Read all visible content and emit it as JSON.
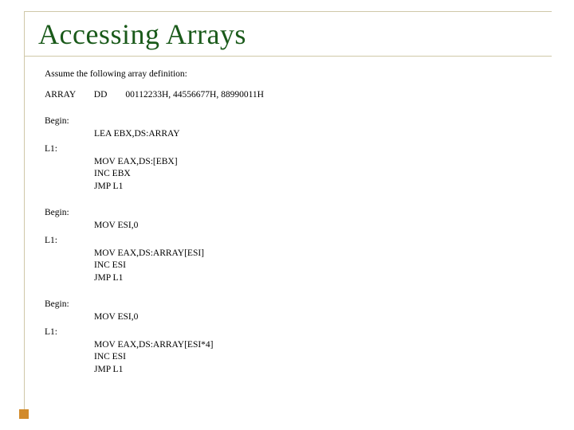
{
  "title": "Accessing Arrays",
  "intro": "Assume the following array definition:",
  "array_def": "ARRAY        DD        00112233H, 44556677H, 88990011H",
  "blocks": [
    {
      "begin_label": "Begin:",
      "begin_instr": "LEA EBX,DS:ARRAY",
      "l1_label": "L1:",
      "lines": [
        "MOV EAX,DS:[EBX]",
        "INC EBX",
        "JMP L1"
      ]
    },
    {
      "begin_label": "Begin:",
      "begin_instr": "MOV ESI,0",
      "l1_label": "L1:",
      "lines": [
        "MOV EAX,DS:ARRAY[ESI]",
        "INC ESI",
        "JMP L1"
      ]
    },
    {
      "begin_label": "Begin:",
      "begin_instr": "MOV ESI,0",
      "l1_label": "L1:",
      "lines": [
        "MOV EAX,DS:ARRAY[ESI*4]",
        "INC ESI",
        "JMP L1"
      ]
    }
  ]
}
